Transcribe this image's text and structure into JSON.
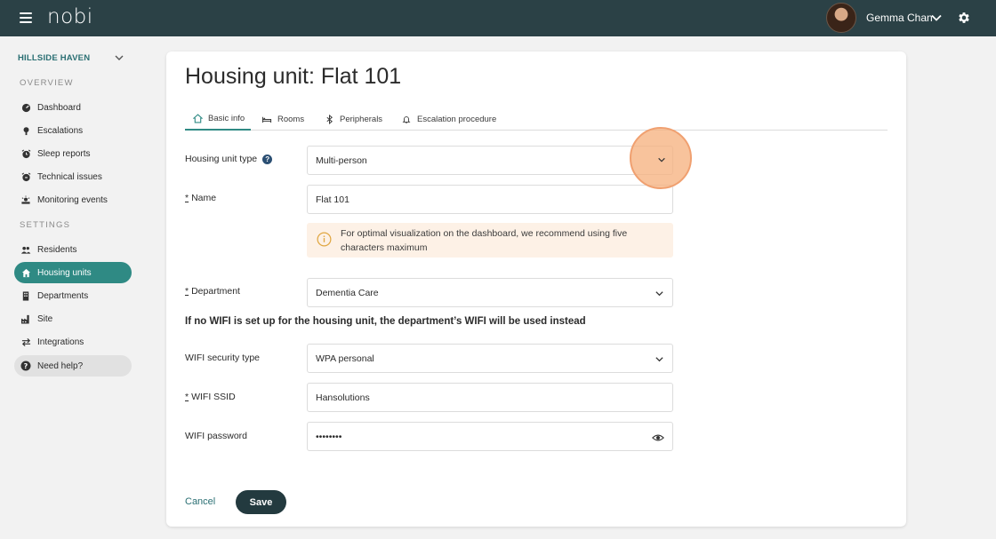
{
  "topbar": {
    "logo": "nobi",
    "user_name": "Gemma Chan"
  },
  "sidebar": {
    "organization": "HILLSIDE HAVEN",
    "overview_title": "OVERVIEW",
    "overview_items": [
      {
        "label": "Dashboard",
        "icon": "dashboard-icon"
      },
      {
        "label": "Escalations",
        "icon": "escalation-icon"
      },
      {
        "label": "Sleep reports",
        "icon": "alarm-clock-icon"
      },
      {
        "label": "Technical issues",
        "icon": "technical-alarm-icon"
      },
      {
        "label": "Monitoring events",
        "icon": "monitoring-icon"
      }
    ],
    "settings_title": "SETTINGS",
    "settings_items": [
      {
        "label": "Residents",
        "icon": "people-icon"
      },
      {
        "label": "Housing units",
        "icon": "home-icon",
        "active": true
      },
      {
        "label": "Departments",
        "icon": "building-icon"
      },
      {
        "label": "Site",
        "icon": "factory-icon"
      },
      {
        "label": "Integrations",
        "icon": "swap-arrows-icon"
      }
    ],
    "help_label": "Need help?"
  },
  "page": {
    "title": "Housing unit: Flat 101",
    "tabs": [
      {
        "label": "Basic info",
        "icon": "home-outline-icon",
        "active": true
      },
      {
        "label": "Rooms",
        "icon": "bed-icon"
      },
      {
        "label": "Peripherals",
        "icon": "bluetooth-icon"
      },
      {
        "label": "Escalation procedure",
        "icon": "bell-icon"
      }
    ]
  },
  "form": {
    "housing_type": {
      "label": "Housing unit type",
      "value": "Multi-person"
    },
    "name": {
      "required_mark": "*",
      "label": "Name",
      "value": "Flat 101"
    },
    "notice": "For optimal visualization on the dashboard, we recommend using five characters maximum",
    "department": {
      "required_mark": "*",
      "label": "Department",
      "value": "Dementia Care"
    },
    "wifi_note": "If no WIFI is set up for the housing unit, the department’s WIFI will be used instead",
    "wifi_security": {
      "label": "WIFI security type",
      "value": "WPA personal"
    },
    "wifi_ssid": {
      "required_mark": "*",
      "label": "WIFI SSID",
      "value": "Hansolutions"
    },
    "wifi_password": {
      "label": "WIFI password",
      "value": "••••••••"
    },
    "cancel_label": "Cancel",
    "save_label": "Save"
  },
  "colors": {
    "topbar": "#2b4146",
    "accent": "#2f8a84",
    "highlight": "#f6b280"
  }
}
